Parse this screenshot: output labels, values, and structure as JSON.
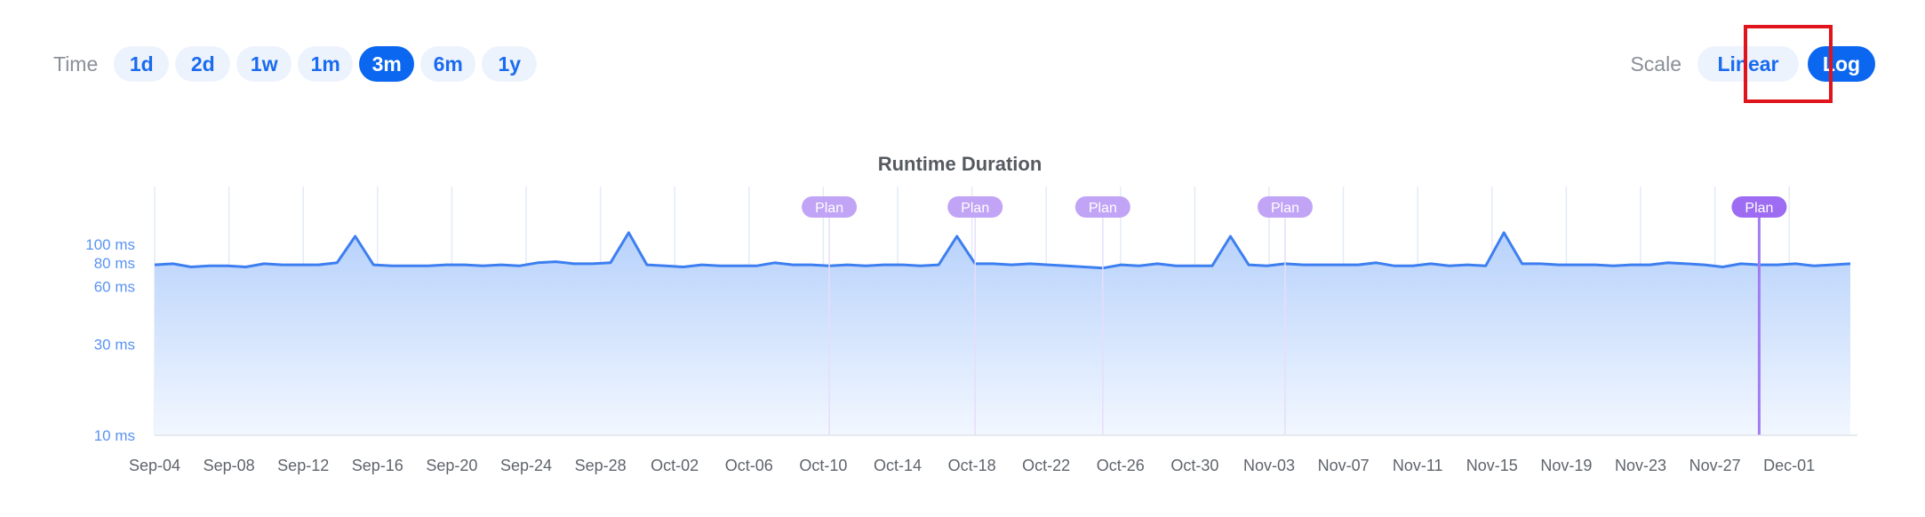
{
  "toolbar": {
    "time_label": "Time",
    "time_options": [
      "1d",
      "2d",
      "1w",
      "1m",
      "3m",
      "6m",
      "1y"
    ],
    "time_selected": "3m",
    "scale_label": "Scale",
    "scale_options": [
      "Linear",
      "Log"
    ],
    "scale_selected": "Log"
  },
  "colors": {
    "accent": "#0b66f0",
    "pill_bg": "#edf3fd",
    "line": "#3d7ff0",
    "plan_marker": "#a47df0",
    "highlight": "#e0141c"
  },
  "chart_data": {
    "type": "area",
    "title": "Runtime Duration",
    "scale": "log",
    "y_unit": "ms",
    "ylim": [
      10,
      180
    ],
    "y_ticks": [
      {
        "value": 10,
        "label": "10 ms"
      },
      {
        "value": 30,
        "label": "30 ms"
      },
      {
        "value": 60,
        "label": "60 ms"
      },
      {
        "value": 80,
        "label": "80 ms"
      },
      {
        "value": 100,
        "label": "100 ms"
      }
    ],
    "x_ticks": [
      "Sep-04",
      "Sep-08",
      "Sep-12",
      "Sep-16",
      "Sep-20",
      "Sep-24",
      "Sep-28",
      "Oct-02",
      "Oct-06",
      "Oct-10",
      "Oct-14",
      "Oct-18",
      "Oct-22",
      "Oct-26",
      "Oct-30",
      "Nov-03",
      "Nov-07",
      "Nov-11",
      "Nov-15",
      "Nov-19",
      "Nov-23",
      "Nov-27",
      "Dec-01"
    ],
    "grid": "vertical",
    "series": [
      {
        "values": [
          78,
          79,
          76,
          77,
          77,
          76,
          79,
          78,
          78,
          78,
          80,
          110,
          78,
          77,
          77,
          77,
          78,
          78,
          77,
          78,
          77,
          80,
          81,
          79,
          79,
          80,
          115,
          78,
          77,
          76,
          78,
          77,
          77,
          77,
          80,
          78,
          78,
          77,
          78,
          77,
          78,
          78,
          77,
          78,
          110,
          79,
          79,
          78,
          79,
          78,
          77,
          76,
          75,
          78,
          77,
          79,
          77,
          77,
          77,
          110,
          78,
          77,
          79,
          78,
          78,
          78,
          78,
          80,
          77,
          77,
          79,
          77,
          78,
          77,
          115,
          79,
          79,
          78,
          78,
          78,
          77,
          78,
          78,
          80,
          79,
          78,
          76,
          79,
          78,
          78,
          79,
          77,
          78,
          79
        ]
      }
    ],
    "plan_markers": [
      {
        "label": "Plan",
        "index": 37
      },
      {
        "label": "Plan",
        "index": 45
      },
      {
        "label": "Plan",
        "index": 52
      },
      {
        "label": "Plan",
        "index": 62
      },
      {
        "label": "Plan",
        "index": 88,
        "selected": true
      }
    ]
  }
}
